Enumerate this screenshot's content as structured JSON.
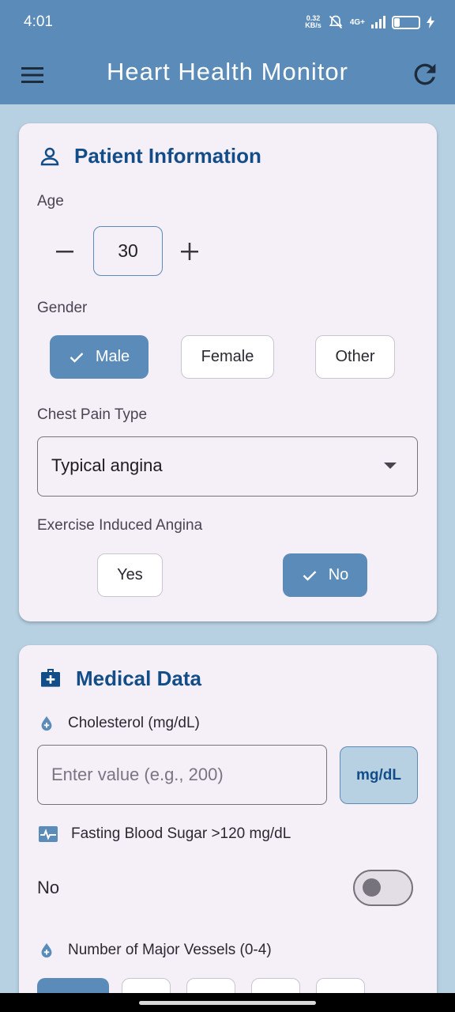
{
  "status": {
    "time": "4:01",
    "speed_value": "0.32",
    "speed_unit": "KB/s",
    "network": "4G+",
    "battery": "23",
    "battery_level": 0.23
  },
  "appbar": {
    "title": "Heart Health Monitor",
    "menu_icon": "menu-icon",
    "refresh_icon": "refresh-icon"
  },
  "patient": {
    "title": "Patient Information",
    "age_label": "Age",
    "age_value": "30",
    "gender_label": "Gender",
    "gender_options": [
      "Male",
      "Female",
      "Other"
    ],
    "gender_selected": "Male",
    "chest_pain_label": "Chest Pain Type",
    "chest_pain_value": "Typical angina",
    "angina_label": "Exercise Induced Angina",
    "angina_options": [
      "Yes",
      "No"
    ],
    "angina_selected": "No"
  },
  "medical": {
    "title": "Medical Data",
    "cholesterol_label": "Cholesterol (mg/dL)",
    "cholesterol_placeholder": "Enter value (e.g., 200)",
    "cholesterol_unit": "mg/dL",
    "fbs_label": "Fasting Blood Sugar >120 mg/dL",
    "fbs_value": "No",
    "fbs_on": false,
    "vessels_label": "Number of Major Vessels (0-4)"
  },
  "colors": {
    "primary": "#5b8bb8",
    "title": "#134d88",
    "background": "#b7d1e3",
    "card": "#f5eff8"
  }
}
